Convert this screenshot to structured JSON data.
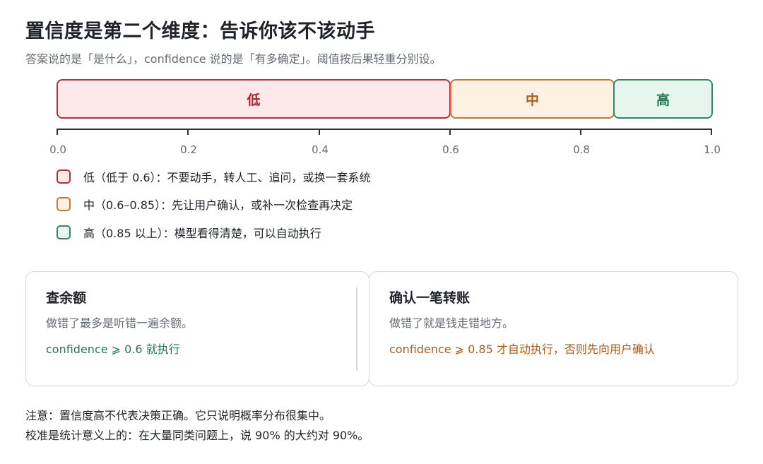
{
  "title": "置信度是第二个维度：告诉你该不该动手",
  "subtitle": "答案说的是「是什么」，confidence 说的是「有多确定」。阈值按后果轻重分别设。",
  "colors": {
    "low_border": "#c2293b",
    "low_fill": "#fde8ea",
    "low_text": "#b0222f",
    "mid_border": "#c8773a",
    "mid_fill": "#fdf1e3",
    "mid_text": "#b05a16",
    "high_border": "#2f8a63",
    "high_fill": "#e6f5ee",
    "high_text": "#1f7a52"
  },
  "chart_data": {
    "type": "bar",
    "segments": [
      {
        "label": "低",
        "from": 0.0,
        "to": 0.6
      },
      {
        "label": "中",
        "from": 0.6,
        "to": 0.85
      },
      {
        "label": "高",
        "from": 0.85,
        "to": 1.0
      }
    ],
    "xlim": [
      0.0,
      1.0
    ],
    "ticks": [
      "0.0",
      "0.2",
      "0.4",
      "0.6",
      "0.8",
      "1.0"
    ]
  },
  "legend": [
    {
      "text": "低（低于 0.6）：不要动手，转人工、追问，或换一套系统"
    },
    {
      "text": "中（0.6–0.85）：先让用户确认，或补一次检查再决定"
    },
    {
      "text": "高（0.85 以上）：模型看得清楚，可以自动执行"
    }
  ],
  "cards": [
    {
      "title": "查余额",
      "desc": "做错了最多是听错一遍余额。",
      "rule": "confidence ⩾ 0.6 就执行"
    },
    {
      "title": "确认一笔转账",
      "desc": "做错了就是钱走错地方。",
      "rule": "confidence ⩾ 0.85 才自动执行，否则先向用户确认"
    }
  ],
  "note": {
    "line1": "注意：置信度高不代表决策正确。它只说明概率分布很集中。",
    "line2": "校准是统计意义上的：在大量同类问题上，说 90% 的大约对 90%。"
  }
}
